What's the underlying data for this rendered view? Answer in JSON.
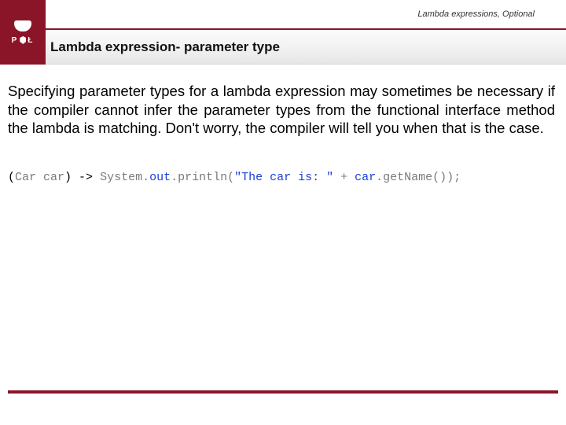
{
  "header": {
    "breadcrumb": "Lambda expressions, Optional",
    "title": "Lambda expression- parameter type",
    "logo_letters_left": "P",
    "logo_letters_right": "Ł"
  },
  "body": {
    "paragraph": "Specifying parameter types for a lambda expression may sometimes be necessary if the compiler cannot infer the parameter types from the functional interface method the lambda is matching. Don't worry, the compiler will tell you when that is the case."
  },
  "code": {
    "t1": "(",
    "t2": "Car car",
    "t3": ") ",
    "t4": "-> ",
    "t5": "System.",
    "t6": "out",
    "t7": ".println(",
    "t8": "\"The car is: \"",
    "t9": " + ",
    "t10": "car",
    "t11": ".getName());"
  }
}
